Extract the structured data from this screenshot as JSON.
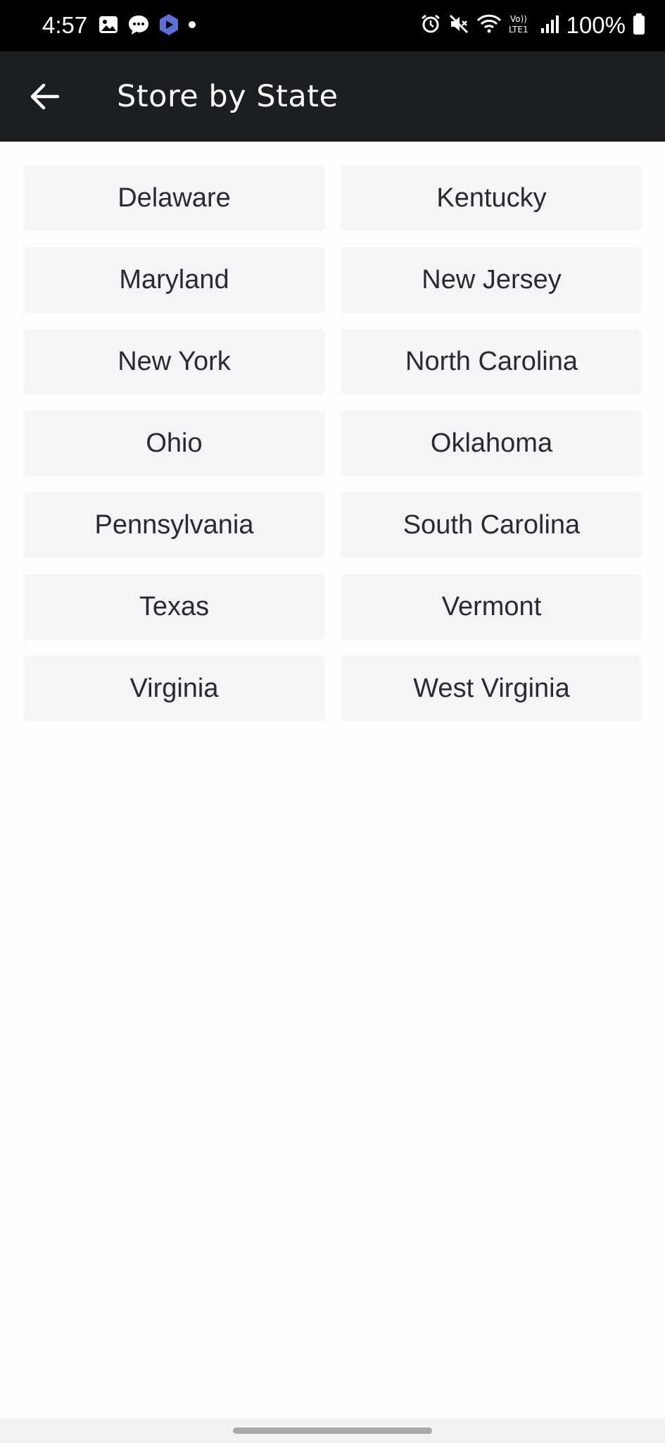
{
  "status_bar": {
    "time": "4:57",
    "battery": "100%",
    "network_label": "Vo)) LTE1",
    "left_icons": [
      "gallery-icon",
      "chat-icon",
      "app-icon",
      "dot-icon"
    ],
    "right_icons": [
      "alarm-icon",
      "mute-icon",
      "wifi-icon",
      "lte-icon",
      "signal-icon",
      "battery-icon"
    ]
  },
  "app_bar": {
    "title": "Store by State",
    "back_icon": "arrow-left-icon"
  },
  "states": [
    "Delaware",
    "Kentucky",
    "Maryland",
    "New Jersey",
    "New York",
    "North Carolina",
    "Ohio",
    "Oklahoma",
    "Pennsylvania",
    "South Carolina",
    "Texas",
    "Vermont",
    "Virginia",
    "West Virginia"
  ],
  "colors": {
    "status_bar_bg": "#000000",
    "app_bar_bg": "#1c1f22",
    "button_bg": "#f5f4f7",
    "button_text": "#2c2a2e",
    "page_bg": "#fefdfe",
    "app_icon_accent": "#5b6fd6"
  }
}
